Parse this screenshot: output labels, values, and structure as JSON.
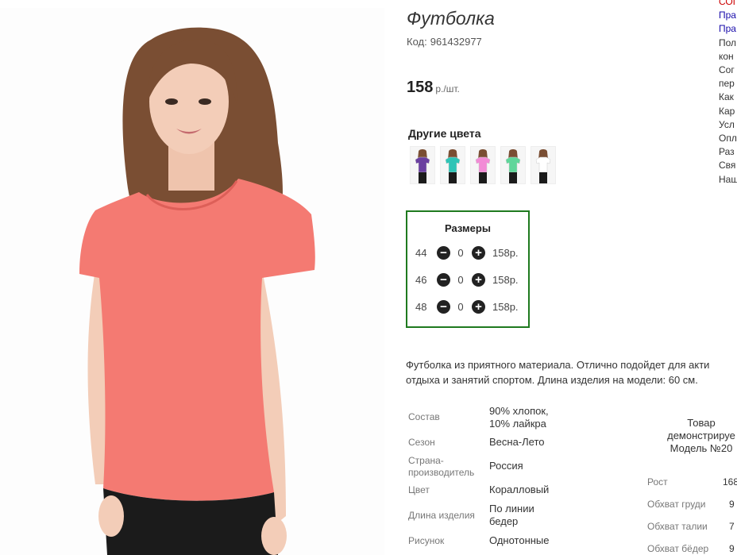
{
  "product": {
    "title": "Футболка",
    "code_label": "Код:",
    "code": "961432977",
    "price": "158",
    "price_unit": "р./шт."
  },
  "other_colors": {
    "heading": "Другие цвета",
    "swatches": [
      {
        "name": "фиолетовый",
        "color": "#6a3fa0"
      },
      {
        "name": "бирюзовый",
        "color": "#2ec4b6"
      },
      {
        "name": "розовый",
        "color": "#f28bd6"
      },
      {
        "name": "мятный",
        "color": "#5fd69a"
      },
      {
        "name": "белый",
        "color": "#ffffff"
      }
    ]
  },
  "sizes": {
    "heading": "Размеры",
    "rows": [
      {
        "size": "44",
        "qty": "0",
        "price": "158р."
      },
      {
        "size": "46",
        "qty": "0",
        "price": "158р."
      },
      {
        "size": "48",
        "qty": "0",
        "price": "158р."
      }
    ]
  },
  "description": {
    "line1": "Футболка из приятного материала. Отлично подойдет для акти",
    "line2": "отдыха и занятий спортом. Длина изделия на модели: 60 см."
  },
  "specs": [
    {
      "label": "Состав",
      "value_lines": [
        "90% хлопок,",
        "10% лайкра"
      ]
    },
    {
      "label": "Сезон",
      "value_lines": [
        "Весна-Лето"
      ]
    },
    {
      "label_lines": [
        "Страна-",
        "производитель"
      ],
      "value_lines": [
        "Россия"
      ]
    },
    {
      "label": "Цвет",
      "value_lines": [
        "Коралловый"
      ]
    },
    {
      "label": "Длина изделия",
      "value_lines": [
        "По линии",
        "бедер"
      ]
    },
    {
      "label": "Рисунок",
      "value_lines": [
        "Однотонные"
      ]
    }
  ],
  "model": {
    "note_lines": [
      "Товар",
      "демонстрируе",
      "Модель №20"
    ],
    "measurements": [
      {
        "label": "Рост",
        "value": "168"
      },
      {
        "label": "Обхват груди",
        "value": "9"
      },
      {
        "label": "Обхват талии",
        "value": "7"
      },
      {
        "label": "Обхват бёдер",
        "value": "9"
      }
    ]
  },
  "sidebar": [
    {
      "text": "СОГ",
      "style": "red"
    },
    {
      "text": "Пра",
      "style": "blue"
    },
    {
      "text": "Пра",
      "style": "blue"
    },
    {
      "text": "Пол",
      "style": "dark"
    },
    {
      "text": "кон",
      "style": "dark"
    },
    {
      "text": "Сог",
      "style": "dark"
    },
    {
      "text": "пер",
      "style": "dark"
    },
    {
      "text": "Как",
      "style": "dark"
    },
    {
      "text": "Кар",
      "style": "dark"
    },
    {
      "text": "Усл",
      "style": "dark"
    },
    {
      "text": "Опл",
      "style": "dark"
    },
    {
      "text": "Раз",
      "style": "dark"
    },
    {
      "text": "Свя",
      "style": "dark"
    },
    {
      "text": "Наш",
      "style": "dark"
    }
  ],
  "colors": {
    "tshirt": "#f47a72",
    "sizes_border": "#1f7a1f",
    "link": "#1a0dab",
    "alert": "#cc0000"
  }
}
